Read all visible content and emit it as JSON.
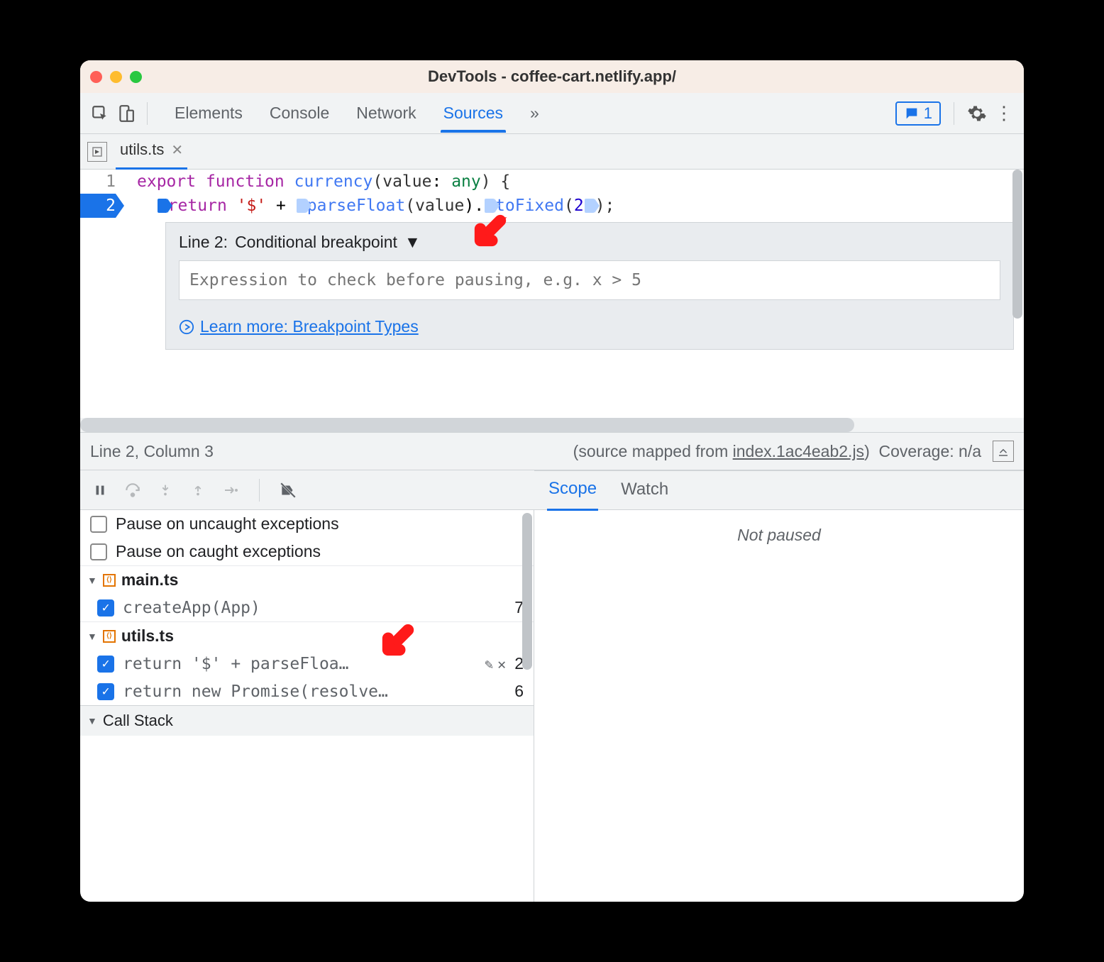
{
  "window": {
    "title": "DevTools - coffee-cart.netlify.app/"
  },
  "toolbar": {
    "tabs": [
      "Elements",
      "Console",
      "Network",
      "Sources"
    ],
    "active_tab": 3,
    "more": "»",
    "issue_count": "1"
  },
  "filetab": {
    "name": "utils.ts"
  },
  "code": {
    "line1_tokens": [
      "export",
      " ",
      "function",
      " ",
      "currency",
      "(",
      "value",
      ": ",
      "any",
      ") {"
    ],
    "line2_tokens": [
      "return",
      " ",
      "'$'",
      " + ",
      "parseFloat",
      "(",
      "value",
      ").",
      "toFixed",
      "(",
      "2",
      ");"
    ],
    "gutter": [
      "1",
      "2"
    ]
  },
  "bp_dialog": {
    "label_pre": "Line 2:  ",
    "type": "Conditional breakpoint",
    "placeholder": "Expression to check before pausing, e.g. x > 5",
    "learn_more": "Learn more: Breakpoint Types"
  },
  "status": {
    "pos": "Line 2, Column 3",
    "mapped_pre": "(source mapped from ",
    "mapped_link": "index.1ac4eab2.js",
    "mapped_post": ")",
    "coverage": "Coverage: n/a"
  },
  "pause_opts": {
    "uncaught": "Pause on uncaught exceptions",
    "caught": "Pause on caught exceptions"
  },
  "bp_tree": {
    "files": [
      {
        "name": "main.ts",
        "items": [
          {
            "text": "createApp(App)",
            "line": "7"
          }
        ]
      },
      {
        "name": "utils.ts",
        "items": [
          {
            "text": "return '$' + parseFloa…",
            "line": "2",
            "editable": true
          },
          {
            "text": "return new Promise(resolve…",
            "line": "6"
          }
        ]
      }
    ],
    "call_stack": "Call Stack"
  },
  "right": {
    "tabs": [
      "Scope",
      "Watch"
    ],
    "active": 0,
    "not_paused": "Not paused"
  }
}
